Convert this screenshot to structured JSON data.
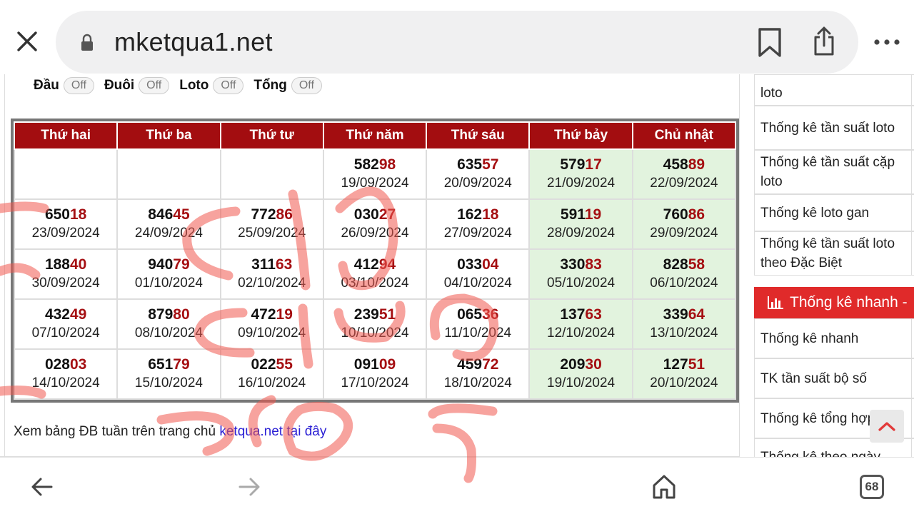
{
  "browser": {
    "url": "mketqua1.net",
    "tab_count": "68"
  },
  "filters": {
    "items": [
      {
        "label": "Đầu",
        "toggle": "Off"
      },
      {
        "label": "Đuôi",
        "toggle": "Off"
      },
      {
        "label": "Loto",
        "toggle": "Off"
      },
      {
        "label": "Tổng",
        "toggle": "Off"
      }
    ]
  },
  "table": {
    "headers": [
      "Thứ hai",
      "Thứ ba",
      "Thứ tư",
      "Thứ năm",
      "Thứ sáu",
      "Thứ bảy",
      "Chủ nhật"
    ],
    "rows": [
      [
        {
          "head": "",
          "tail": "",
          "date": ""
        },
        {
          "head": "",
          "tail": "",
          "date": ""
        },
        {
          "head": "",
          "tail": "",
          "date": ""
        },
        {
          "head": "582",
          "tail": "98",
          "date": "19/09/2024"
        },
        {
          "head": "635",
          "tail": "57",
          "date": "20/09/2024"
        },
        {
          "head": "579",
          "tail": "17",
          "date": "21/09/2024"
        },
        {
          "head": "458",
          "tail": "89",
          "date": "22/09/2024"
        }
      ],
      [
        {
          "head": "650",
          "tail": "18",
          "date": "23/09/2024"
        },
        {
          "head": "846",
          "tail": "45",
          "date": "24/09/2024"
        },
        {
          "head": "772",
          "tail": "86",
          "date": "25/09/2024"
        },
        {
          "head": "030",
          "tail": "27",
          "date": "26/09/2024"
        },
        {
          "head": "162",
          "tail": "18",
          "date": "27/09/2024"
        },
        {
          "head": "591",
          "tail": "19",
          "date": "28/09/2024"
        },
        {
          "head": "760",
          "tail": "86",
          "date": "29/09/2024"
        }
      ],
      [
        {
          "head": "188",
          "tail": "40",
          "date": "30/09/2024"
        },
        {
          "head": "940",
          "tail": "79",
          "date": "01/10/2024"
        },
        {
          "head": "311",
          "tail": "63",
          "date": "02/10/2024"
        },
        {
          "head": "412",
          "tail": "94",
          "date": "03/10/2024"
        },
        {
          "head": "033",
          "tail": "04",
          "date": "04/10/2024"
        },
        {
          "head": "330",
          "tail": "83",
          "date": "05/10/2024"
        },
        {
          "head": "828",
          "tail": "58",
          "date": "06/10/2024"
        }
      ],
      [
        {
          "head": "432",
          "tail": "49",
          "date": "07/10/2024"
        },
        {
          "head": "879",
          "tail": "80",
          "date": "08/10/2024"
        },
        {
          "head": "472",
          "tail": "19",
          "date": "09/10/2024"
        },
        {
          "head": "239",
          "tail": "51",
          "date": "10/10/2024"
        },
        {
          "head": "065",
          "tail": "36",
          "date": "11/10/2024"
        },
        {
          "head": "137",
          "tail": "63",
          "date": "12/10/2024"
        },
        {
          "head": "339",
          "tail": "64",
          "date": "13/10/2024"
        }
      ],
      [
        {
          "head": "028",
          "tail": "03",
          "date": "14/10/2024"
        },
        {
          "head": "651",
          "tail": "79",
          "date": "15/10/2024"
        },
        {
          "head": "022",
          "tail": "55",
          "date": "16/10/2024"
        },
        {
          "head": "091",
          "tail": "09",
          "date": "17/10/2024"
        },
        {
          "head": "459",
          "tail": "72",
          "date": "18/10/2024"
        },
        {
          "head": "209",
          "tail": "30",
          "date": "19/10/2024"
        },
        {
          "head": "127",
          "tail": "51",
          "date": "20/10/2024"
        }
      ]
    ]
  },
  "footer": {
    "text": "Xem bảng ĐB tuần trên trang chủ",
    "link_site": "ketqua.net",
    "link_here": "tại đây"
  },
  "sidebar": {
    "top_items": [
      "loto",
      "Thống kê tần suất loto",
      "Thống kê tần suất cặp loto",
      "Thống kê loto gan",
      "Thống kê tần suất loto theo Đặc Biệt"
    ],
    "quick_header": "Thống kê nhanh -",
    "quick_items": [
      "Thống kê nhanh",
      "TK tần suất bộ số",
      "Thống kê tổng hợp",
      "Thống kê theo ngày"
    ]
  },
  "colors": {
    "header_red": "#a30d10",
    "weekend_green": "#e2f3de",
    "quick_red": "#e02a2a",
    "link_blue": "#2a1fd4"
  }
}
